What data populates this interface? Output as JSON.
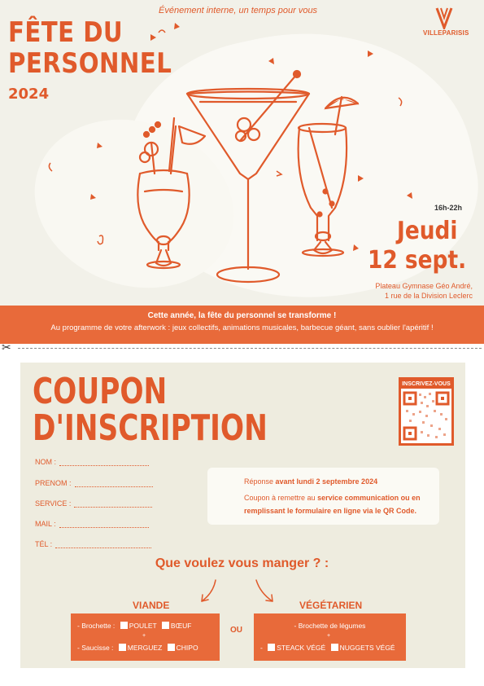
{
  "header": {
    "tagline": "Événement interne, un temps pour vous",
    "title_line1": "FÊTE DU",
    "title_line2": "PERSONNEL",
    "year": "2024",
    "logo_text": "VILLEPARISIS"
  },
  "event": {
    "hours": "16h-22h",
    "day": "Jeudi",
    "date": "12 sept.",
    "venue_line1": "Plateau Gymnase Géo André,",
    "venue_line2": "1 rue de la Division Leclerc"
  },
  "banner": {
    "line1": "Cette année, la fête du personnel se transforme !",
    "line2": "Au programme de votre afterwork : jeux collectifs, animations musicales, barbecue géant, sans oublier l'apéritif !"
  },
  "coupon": {
    "title_line1": "COUPON",
    "title_line2": "D'INSCRIPTION",
    "qr_label": "INSCRIVEZ-VOUS",
    "fields": [
      "NOM :",
      "PRENOM :",
      "SERVICE :",
      "MAIL :",
      "TÉL :"
    ],
    "reply_prefix": "Réponse ",
    "reply_deadline": "avant lundi 2 septembre 2024",
    "return_line1_prefix": "Coupon à remettre au ",
    "return_service": "service communication",
    "return_line1_suffix": " ou en",
    "return_line2": "remplissant le formulaire en ligne via le QR Code."
  },
  "menu": {
    "question": "Que voulez vous manger ? :",
    "or_label": "OU",
    "meat": {
      "title": "VIANDE",
      "brochette_label": "- Brochette :",
      "brochette_opt1": "POULET",
      "brochette_opt2": "BŒUF",
      "plus": "+",
      "saucisse_label": "- Saucisse :",
      "saucisse_opt1": "MERGUEZ",
      "saucisse_opt2": "CHIPO"
    },
    "veg": {
      "title": "VÉGÉTARIEN",
      "brochette_label": "- Brochette de légumes",
      "plus": "+",
      "dash": "-",
      "opt1": "STEACK VÉGÉ",
      "opt2": "NUGGETS VÉGÉ"
    }
  },
  "colors": {
    "accent": "#e05a2b",
    "band": "#e86a3a",
    "paper": "#f2f1e9"
  }
}
